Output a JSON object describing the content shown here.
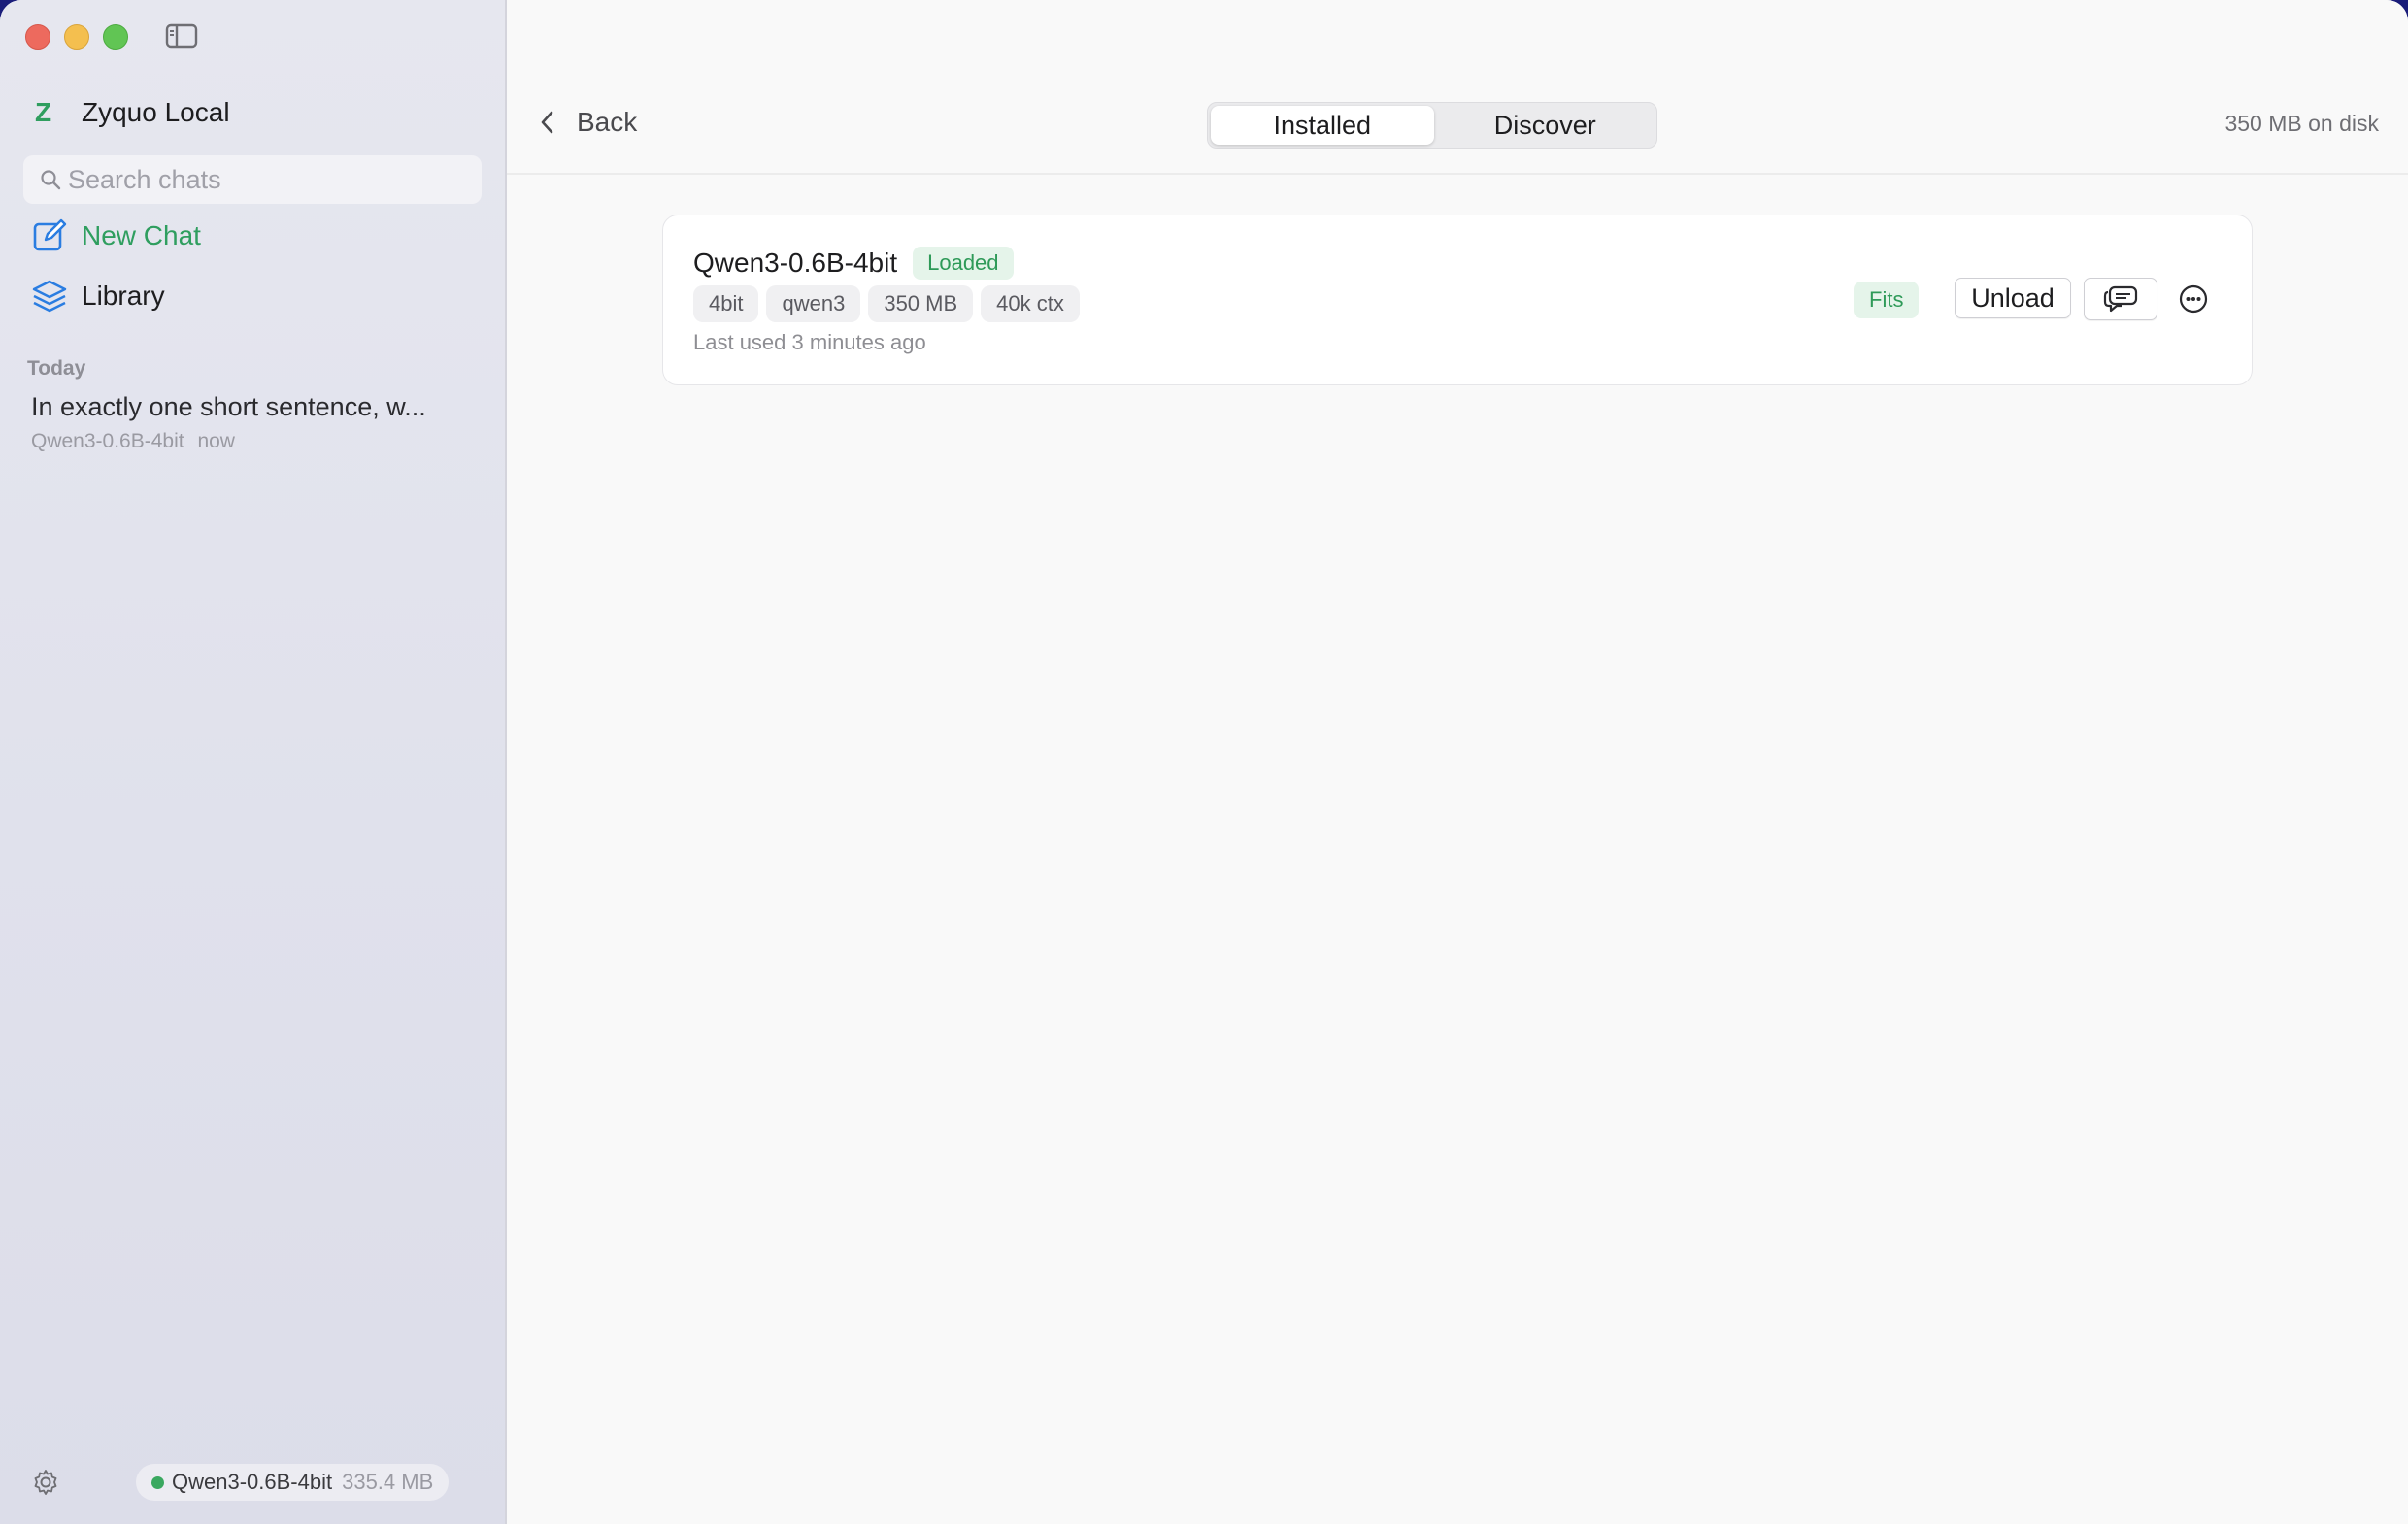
{
  "window": {
    "sidebar_toggle_icon": "sidebar-toggle-icon"
  },
  "sidebar": {
    "app_logo": "Z",
    "app_name": "Zyquo Local",
    "search_placeholder": "Search chats",
    "new_chat_label": "New Chat",
    "library_label": "Library",
    "section_today": "Today",
    "chats": [
      {
        "title": "In exactly one short sentence, w...",
        "model": "Qwen3-0.6B-4bit",
        "time": "now"
      }
    ],
    "footer": {
      "model_name": "Qwen3-0.6B-4bit",
      "memory": "335.4 MB",
      "status_color": "#3aa860"
    }
  },
  "header": {
    "back_label": "Back",
    "tabs": [
      {
        "label": "Installed",
        "active": true
      },
      {
        "label": "Discover",
        "active": false
      }
    ],
    "disk_usage": "350 MB on disk"
  },
  "models": [
    {
      "name": "Qwen3-0.6B-4bit",
      "status": "Loaded",
      "tags": [
        "4bit",
        "qwen3",
        "350 MB",
        "40k ctx"
      ],
      "last_used": "Last used 3 minutes ago",
      "fit_label": "Fits",
      "unload_label": "Unload"
    }
  ],
  "colors": {
    "accent_green": "#2f9e5f",
    "badge_bg": "#e5f4ea"
  }
}
